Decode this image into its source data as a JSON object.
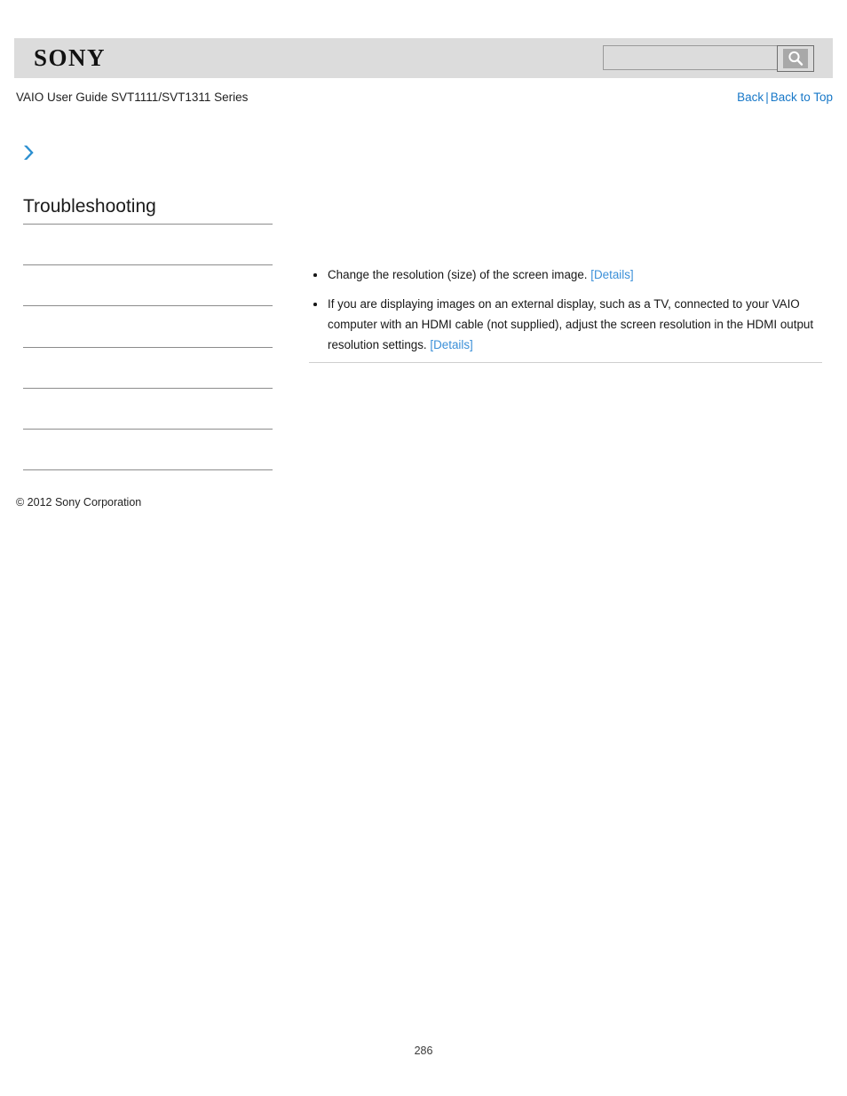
{
  "header": {
    "logo_text": "SONY",
    "search": {
      "value": "",
      "placeholder": "",
      "icon": "search-icon",
      "button_label": ""
    }
  },
  "subheader": {
    "doc_title": "VAIO User Guide SVT1111/SVT1311 Series",
    "back_label": "Back",
    "separator": "|",
    "back_to_top_label": "Back to Top"
  },
  "breadcrumb": {
    "arrow_icon": "chevron-right-icon"
  },
  "sidebar": {
    "heading": "Troubleshooting",
    "items": [
      {
        "label": ""
      },
      {
        "label": ""
      },
      {
        "label": ""
      },
      {
        "label": ""
      },
      {
        "label": ""
      },
      {
        "label": ""
      }
    ]
  },
  "main": {
    "bullets": [
      {
        "text": "Change the resolution (size) of the screen image.",
        "link_label": "[Details]"
      },
      {
        "text": "If you are displaying images on an external display, such as a TV, connected to your VAIO computer with an HDMI cable (not supplied), adjust the screen resolution in the HDMI output resolution settings.",
        "link_label": "[Details]"
      }
    ]
  },
  "footer": {
    "copyright": "© 2012 Sony Corporation",
    "page_number": "286"
  },
  "colors": {
    "header_band": "#dcdcdc",
    "link_blue": "#1878c8",
    "details_blue": "#3a8fd8",
    "rule_gray": "#8c8c8c",
    "content_rule": "#cfcfcf",
    "arrow_blue": "#2b8fd0"
  }
}
